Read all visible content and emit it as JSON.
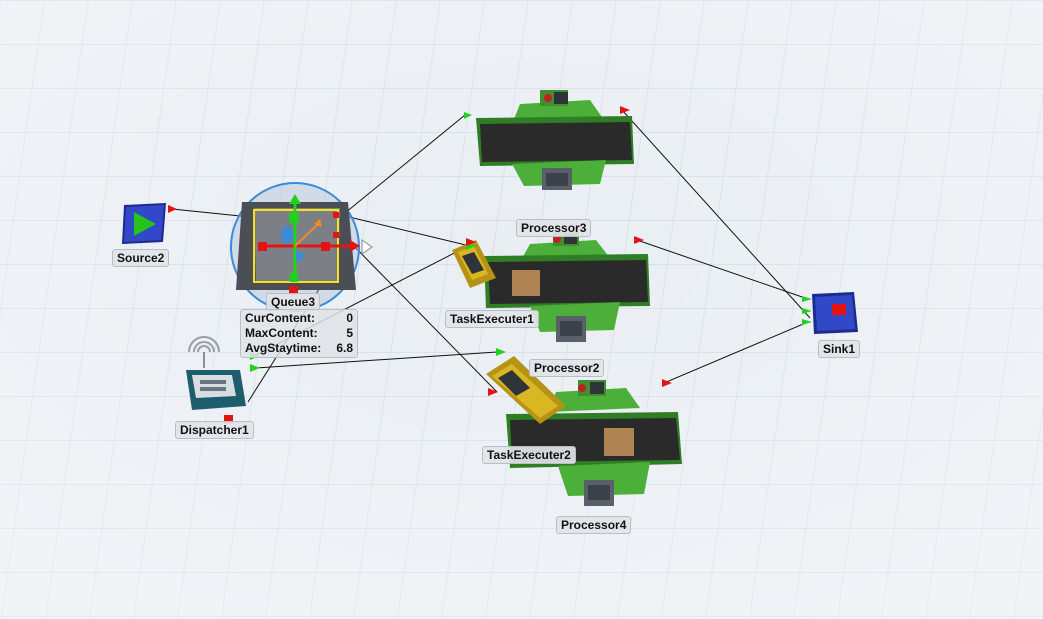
{
  "objects": {
    "source2": {
      "label": "Source2"
    },
    "queue3": {
      "label": "Queue3",
      "stats": [
        {
          "name": "CurContent:",
          "value": "0"
        },
        {
          "name": "MaxContent:",
          "value": "5"
        },
        {
          "name": "AvgStaytime:",
          "value": "6.8"
        }
      ]
    },
    "dispatcher1": {
      "label": "Dispatcher1"
    },
    "processor3": {
      "label": "Processor3"
    },
    "processor2": {
      "label": "Processor2"
    },
    "processor4": {
      "label": "Processor4"
    },
    "taskexecuter1": {
      "label": "TaskExecuter1"
    },
    "taskexecuter2": {
      "label": "TaskExecuter2"
    },
    "sink1": {
      "label": "Sink1"
    }
  },
  "colors": {
    "grid_line": "#c9d6e2",
    "floor": "#e9eef3",
    "conveyor_frame": "#4caf3a",
    "conveyor_belt": "#2c2c2c",
    "source_sink_blue": "#2233aa",
    "queue_box": "#5d6166",
    "selection_yellow": "#f2e31c",
    "selection_ring": "#3a8bd8",
    "port_output": "#e41414",
    "port_input": "#22d11e",
    "task_executer_yellow": "#d8b722",
    "box_tan": "#b08355"
  }
}
